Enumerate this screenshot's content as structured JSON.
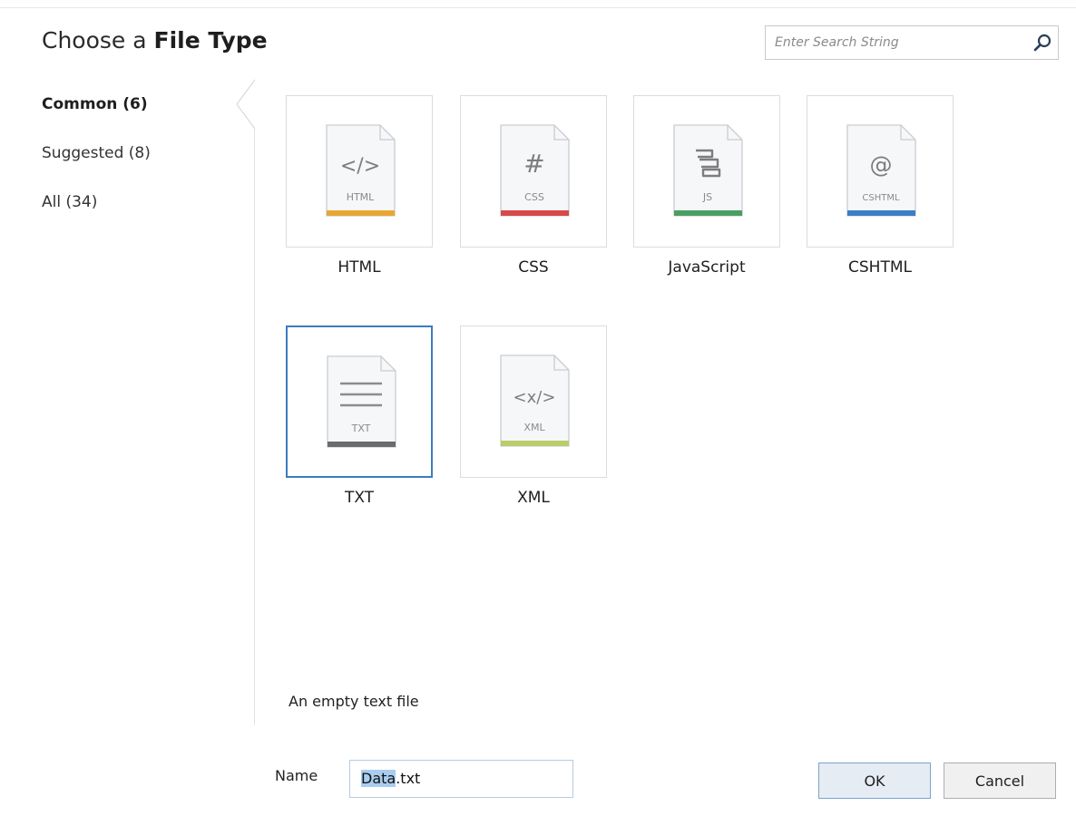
{
  "dialog": {
    "title_prefix": "Choose a ",
    "title_bold": "File Type"
  },
  "search": {
    "placeholder": "Enter Search String",
    "icon": "search-icon"
  },
  "categories": [
    {
      "label": "Common (6)",
      "active": true
    },
    {
      "label": "Suggested (8)",
      "active": false
    },
    {
      "label": "All (34)",
      "active": false
    }
  ],
  "file_types": [
    {
      "name": "HTML",
      "glyph": "</>",
      "badge": "HTML",
      "color": "#e8a735",
      "selected": false
    },
    {
      "name": "CSS",
      "glyph": "#",
      "badge": "CSS",
      "color": "#d9484a",
      "selected": false
    },
    {
      "name": "JavaScript",
      "glyph": "",
      "badge": "JS",
      "color": "#4a9e63",
      "selected": false
    },
    {
      "name": "CSHTML",
      "glyph": "@",
      "badge": "CSHTML",
      "color": "#3a7dc9",
      "selected": false
    },
    {
      "name": "TXT",
      "glyph": "",
      "badge": "TXT",
      "color": "#6c6c6c",
      "selected": true
    },
    {
      "name": "XML",
      "glyph": "<x/>",
      "badge": "XML",
      "color": "#b9ce6a",
      "selected": false
    }
  ],
  "description": "An empty text file",
  "name_field": {
    "label": "Name",
    "value_selected": "Data",
    "value_rest": ".txt"
  },
  "buttons": {
    "ok": "OK",
    "cancel": "Cancel"
  },
  "colors": {
    "selection_border": "#3d7bbf",
    "text_selection": "#a9cdf0",
    "ok_border": "#7aa3cf"
  }
}
